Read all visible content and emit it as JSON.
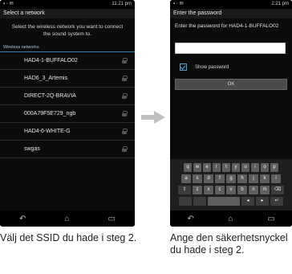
{
  "left_screen": {
    "status_time": "11:21 pm",
    "title": "Select a network",
    "instruction": "Select the wireless network you want to connect the sound system to.",
    "section_header": "Wireless networks",
    "networks": [
      {
        "ssid": "HAD4-1-BUFFALO02"
      },
      {
        "ssid": "HAD6_3_Artemis"
      },
      {
        "ssid": "DIRECT-2Q-BRAVIA"
      },
      {
        "ssid": "000A79F5E729_ngb"
      },
      {
        "ssid": "HAD4-6-WHITE-G"
      },
      {
        "ssid": "swgas"
      }
    ]
  },
  "right_screen": {
    "status_time": "2:21 pm",
    "title": "Enter the password",
    "prompt": "Enter the password for HAD4-1-BUFFALO02",
    "password_value": "",
    "show_password_label": "Show password",
    "show_password_checked": true,
    "ok_label": "OK",
    "keyboard": {
      "row1": [
        "q",
        "w",
        "e",
        "r",
        "t",
        "y",
        "u",
        "i",
        "o",
        "p"
      ],
      "row2": [
        "a",
        "s",
        "d",
        "f",
        "g",
        "h",
        "j",
        "k",
        "l"
      ],
      "row3": [
        "z",
        "x",
        "c",
        "v",
        "b",
        "n",
        "m"
      ]
    }
  },
  "captions": {
    "left": "Välj det SSID du hade i steg 2.",
    "right": "Ange den säkerhetsnyckel du hade i steg 2."
  },
  "colors": {
    "accent_blue": "#2e7fae",
    "arrow_gray": "#c0c0c0"
  }
}
